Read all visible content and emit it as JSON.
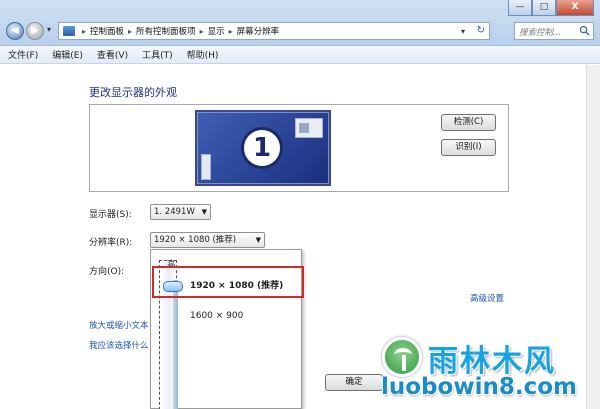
{
  "window": {
    "minimize": "—",
    "maximize": "□",
    "close": "X"
  },
  "address_bar": {
    "crumbs": [
      "控制面板",
      "所有控制面板项",
      "显示",
      "屏幕分辨率"
    ],
    "separator": "▸",
    "refresh_glyph": "↻"
  },
  "search": {
    "placeholder": "搜索控制..."
  },
  "menu": [
    "文件(F)",
    "编辑(E)",
    "查看(V)",
    "工具(T)",
    "帮助(H)"
  ],
  "page": {
    "title": "更改显示器的外观"
  },
  "monitor": {
    "number": "1"
  },
  "buttons": {
    "detect": "检测(C)",
    "identify": "识别(I)",
    "ok": "确定"
  },
  "form": {
    "display_label": "显示器(S):",
    "display_value": "1. 2491W",
    "resolution_label": "分辨率(R):",
    "resolution_value": "1920 × 1080 (推荐)",
    "orientation_label": "方向(O):"
  },
  "links": {
    "advanced": "高级设置",
    "zoom": "放大或缩小文本",
    "help": "我应该选择什么"
  },
  "dropdown": {
    "high_label": "高",
    "options": [
      "1920 × 1080 (推荐)",
      "1600 × 900"
    ],
    "selected_index": 0
  },
  "watermark": {
    "cn": "雨林木风",
    "en": "luobowin8.com"
  },
  "colors": {
    "accent_link": "#1a55b8",
    "title": "#1e3287",
    "highlight_border": "#d12a2a",
    "watermark": "#17a2e0"
  }
}
